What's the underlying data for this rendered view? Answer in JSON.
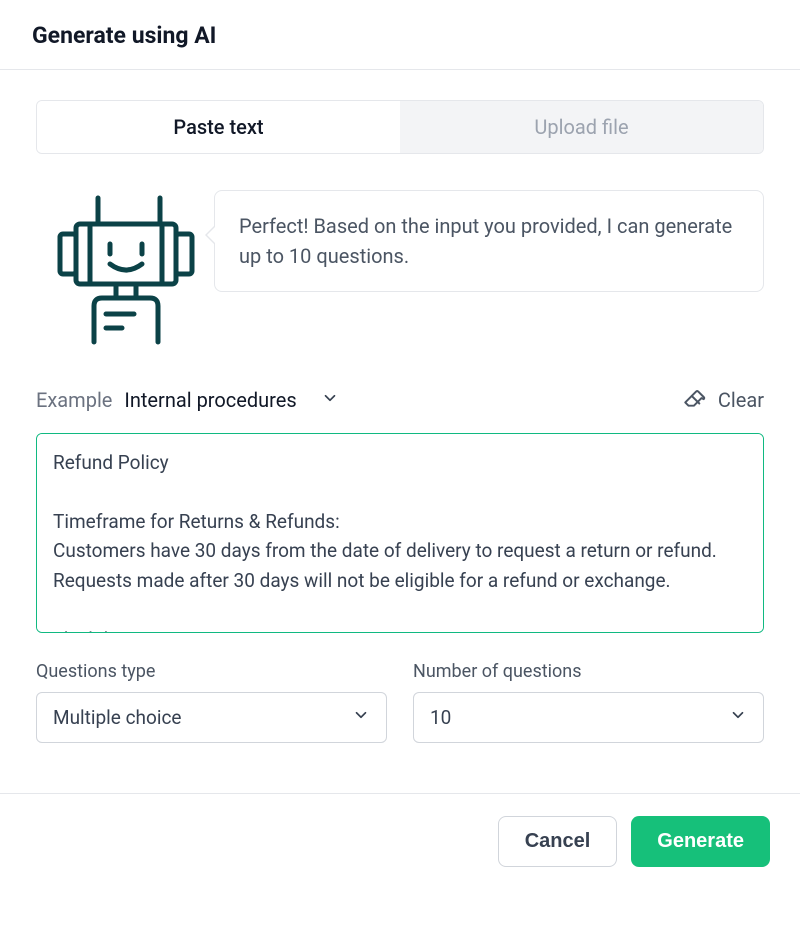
{
  "header": {
    "title": "Generate using AI"
  },
  "tabs": {
    "paste": "Paste text",
    "upload": "Upload file",
    "active": "paste"
  },
  "bot_message": "Perfect! Based on the input you provided, I can generate up to 10 questions.",
  "example": {
    "label": "Example",
    "selected": "Internal procedures"
  },
  "clear_label": "Clear",
  "textarea_value": "Refund Policy\n\nTimeframe for Returns & Refunds:\nCustomers have 30 days from the date of delivery to request a return or refund. Requests made after 30 days will not be eligible for a refund or exchange.\n\nEligibility Criteria:\nTo be eligible for a return or refund, the item must be:",
  "fields": {
    "questions_type": {
      "label": "Questions type",
      "value": "Multiple choice"
    },
    "number_of_questions": {
      "label": "Number of questions",
      "value": "10"
    }
  },
  "footer": {
    "cancel": "Cancel",
    "generate": "Generate"
  },
  "colors": {
    "accent": "#16c07a",
    "focus_border": "#10b981",
    "bot_stroke": "#0b4247"
  }
}
